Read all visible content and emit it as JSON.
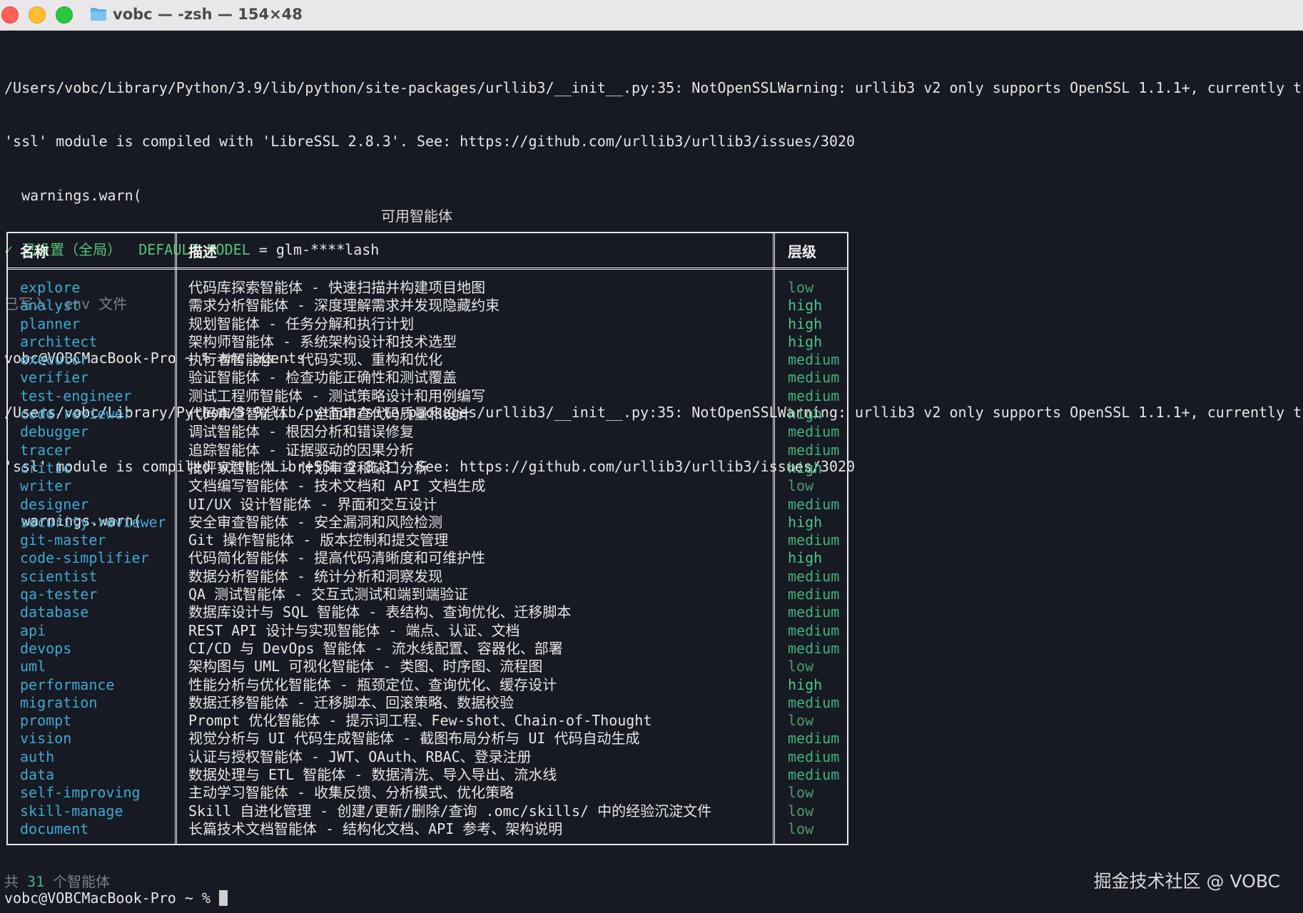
{
  "window": {
    "title": "vobc — -zsh — 154×48"
  },
  "terminal": {
    "lines": [
      "/Users/vobc/Library/Python/3.9/lib/python/site-packages/urllib3/__init__.py:35: NotOpenSSLWarning: urllib3 v2 only supports OpenSSL 1.1.1+, currently the",
      "'ssl' module is compiled with 'LibreSSL 2.8.3'. See: https://github.com/urllib3/urllib3/issues/3020",
      "  warnings.warn("
    ],
    "setting_check": "✓",
    "setting_label": "已设置（全局）",
    "setting_key": "DEFAULT_MODEL",
    "setting_value": " = glm-****lash",
    "env_written": "已写入 .env 文件",
    "prompt_command": "vobc@VOBCMacBook-Pro ~ % omc agents",
    "lines2": [
      "/Users/vobc/Library/Python/3.9/lib/python/site-packages/urllib3/__init__.py:35: NotOpenSSLWarning: urllib3 v2 only supports OpenSSL 1.1.1+, currently the",
      "'ssl' module is compiled with 'LibreSSL 2.8.3'. See: https://github.com/urllib3/urllib3/issues/3020",
      "  warnings.warn("
    ],
    "table_caption": "可用智能体",
    "headers": {
      "name": "名称",
      "desc": "描述",
      "level": "层级"
    },
    "agents": [
      {
        "name": "explore",
        "desc": "代码库探索智能体 - 快速扫描并构建项目地图",
        "level": "low"
      },
      {
        "name": "analyst",
        "desc": "需求分析智能体 - 深度理解需求并发现隐藏约束",
        "level": "high"
      },
      {
        "name": "planner",
        "desc": "规划智能体 - 任务分解和执行计划",
        "level": "high"
      },
      {
        "name": "architect",
        "desc": "架构师智能体 - 系统架构设计和技术选型",
        "level": "high"
      },
      {
        "name": "executor",
        "desc": "执行者智能体 - 代码实现、重构和优化",
        "level": "medium"
      },
      {
        "name": "verifier",
        "desc": "验证智能体 - 检查功能正确性和测试覆盖",
        "level": "medium"
      },
      {
        "name": "test-engineer",
        "desc": "测试工程师智能体 - 测试策略设计和用例编写",
        "level": "medium"
      },
      {
        "name": "code-reviewer",
        "desc": "代码审查智能体 - 全面审查代码质量和设计",
        "level": "high"
      },
      {
        "name": "debugger",
        "desc": "调试智能体 - 根因分析和错误修复",
        "level": "medium"
      },
      {
        "name": "tracer",
        "desc": "追踪智能体 - 证据驱动的因果分析",
        "level": "medium"
      },
      {
        "name": "critic",
        "desc": "批评家智能体 - 计划审查和缺口分析",
        "level": "high"
      },
      {
        "name": "writer",
        "desc": "文档编写智能体 - 技术文档和 API 文档生成",
        "level": "low"
      },
      {
        "name": "designer",
        "desc": "UI/UX 设计智能体 - 界面和交互设计",
        "level": "medium"
      },
      {
        "name": "security-reviewer",
        "desc": "安全审查智能体 - 安全漏洞和风险检测",
        "level": "high"
      },
      {
        "name": "git-master",
        "desc": "Git 操作智能体 - 版本控制和提交管理",
        "level": "medium"
      },
      {
        "name": "code-simplifier",
        "desc": "代码简化智能体 - 提高代码清晰度和可维护性",
        "level": "high"
      },
      {
        "name": "scientist",
        "desc": "数据分析智能体 - 统计分析和洞察发现",
        "level": "medium"
      },
      {
        "name": "qa-tester",
        "desc": "QA 测试智能体 - 交互式测试和端到端验证",
        "level": "medium"
      },
      {
        "name": "database",
        "desc": "数据库设计与 SQL 智能体 - 表结构、查询优化、迁移脚本",
        "level": "medium"
      },
      {
        "name": "api",
        "desc": "REST API 设计与实现智能体 - 端点、认证、文档",
        "level": "medium"
      },
      {
        "name": "devops",
        "desc": "CI/CD 与 DevOps 智能体 - 流水线配置、容器化、部署",
        "level": "medium"
      },
      {
        "name": "uml",
        "desc": "架构图与 UML 可视化智能体 - 类图、时序图、流程图",
        "level": "low"
      },
      {
        "name": "performance",
        "desc": "性能分析与优化智能体 - 瓶颈定位、查询优化、缓存设计",
        "level": "high"
      },
      {
        "name": "migration",
        "desc": "数据迁移智能体 - 迁移脚本、回滚策略、数据校验",
        "level": "medium"
      },
      {
        "name": "prompt",
        "desc": "Prompt 优化智能体 - 提示词工程、Few-shot、Chain-of-Thought",
        "level": "low"
      },
      {
        "name": "vision",
        "desc": "视觉分析与 UI 代码生成智能体 - 截图布局分析与 UI 代码自动生成",
        "level": "medium"
      },
      {
        "name": "auth",
        "desc": "认证与授权智能体 - JWT、OAuth、RBAC、登录注册",
        "level": "medium"
      },
      {
        "name": "data",
        "desc": "数据处理与 ETL 智能体 - 数据清洗、导入导出、流水线",
        "level": "medium"
      },
      {
        "name": "self-improving",
        "desc": "主动学习智能体 - 收集反馈、分析模式、优化策略",
        "level": "low"
      },
      {
        "name": "skill-manage",
        "desc": "Skill 自进化管理 - 创建/更新/删除/查询 .omc/skills/ 中的经验沉淀文件",
        "level": "low"
      },
      {
        "name": "document",
        "desc": "长篇技术文档智能体 - 结构化文档、API 参考、架构说明",
        "level": "low"
      }
    ],
    "count_prefix": "共 ",
    "count_value": "31",
    "count_suffix": " 个智能体",
    "final_prompt": "vobc@VOBCMacBook-Pro ~ % "
  },
  "watermark": "掘金技术社区 @ VOBC",
  "colors": {
    "background": "#171a22",
    "agent_name": "#3fa9d6",
    "level_green": "#3fb37a"
  }
}
